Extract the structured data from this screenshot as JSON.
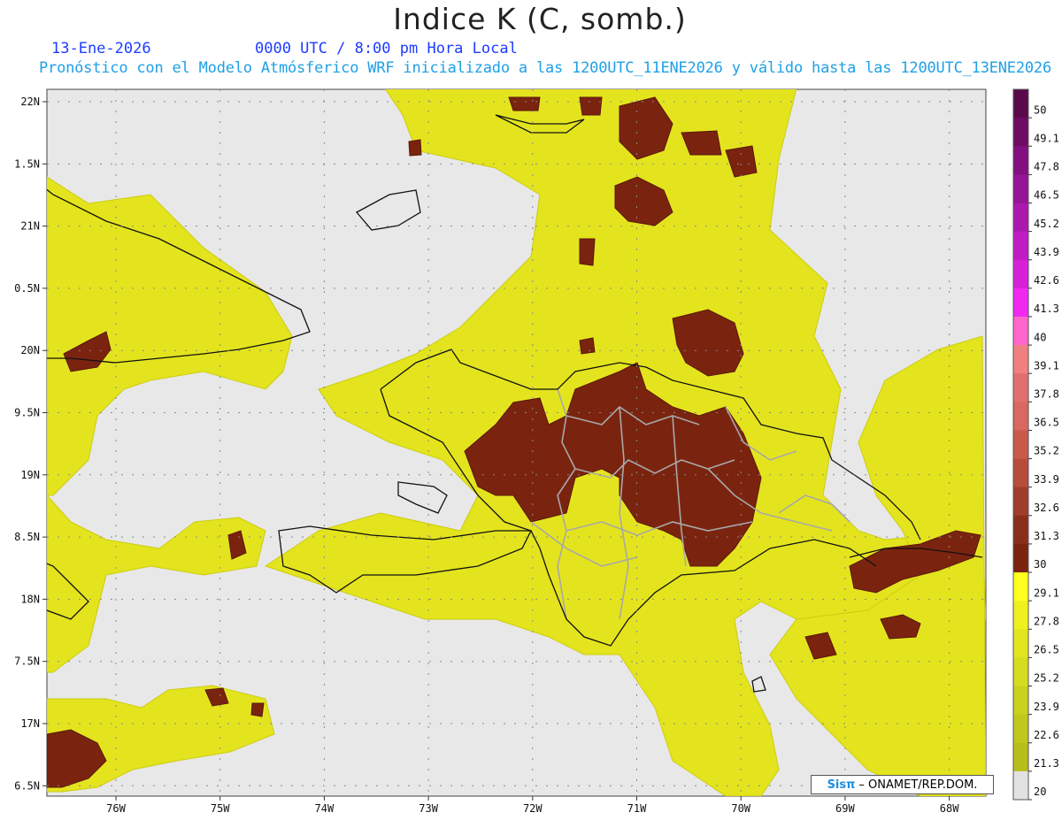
{
  "title": "Indice K (C, somb.)",
  "date_line": "13-Ene-2026",
  "time_line": "0000 UTC / 8:00 pm Hora Local",
  "description_line": "Pronóstico con el Modelo Atmósferico WRF inicializado a las 1200UTC_11ENE2026 y válido hasta las  1200UTC_13ENE2026",
  "map": {
    "longitude_labels": [
      "76W",
      "75W",
      "74W",
      "73W",
      "72W",
      "71W",
      "70W",
      "69W",
      "68W"
    ],
    "latitude_labels": [
      "22N",
      "1.5N",
      "21N",
      "0.5N",
      "20N",
      "9.5N",
      "19N",
      "8.5N",
      "18N",
      "7.5N",
      "17N",
      "6.5N"
    ],
    "background_color": "#e8e8e8",
    "coast_color": "#111111",
    "province_color": "#a8a8a8"
  },
  "colorbar": {
    "labels": [
      "50",
      "49.1",
      "47.8",
      "46.5",
      "45.2",
      "43.9",
      "42.6",
      "41.3",
      "40",
      "39.1",
      "37.8",
      "36.5",
      "35.2",
      "33.9",
      "32.6",
      "31.3",
      "30",
      "29.1",
      "27.8",
      "26.5",
      "25.2",
      "23.9",
      "22.6",
      "21.3",
      "20"
    ],
    "colors": [
      "#5a0a4a",
      "#6e0c64",
      "#82107e",
      "#961496",
      "#aa18ae",
      "#c01cc6",
      "#d820d8",
      "#f028f0",
      "#ff66cc",
      "#f08080",
      "#e07070",
      "#d86860",
      "#c85a4c",
      "#b84c3c",
      "#a03c2c",
      "#8a2e1c",
      "#7a2410",
      "#ffff20",
      "#f0f020",
      "#e2e620",
      "#d6dc20",
      "#cad220",
      "#c0c81e",
      "#b6be1c",
      "#e2e2e2"
    ]
  },
  "credit": {
    "logo": "Sisπ",
    "text": "– ONAMET/REP.DOM."
  }
}
